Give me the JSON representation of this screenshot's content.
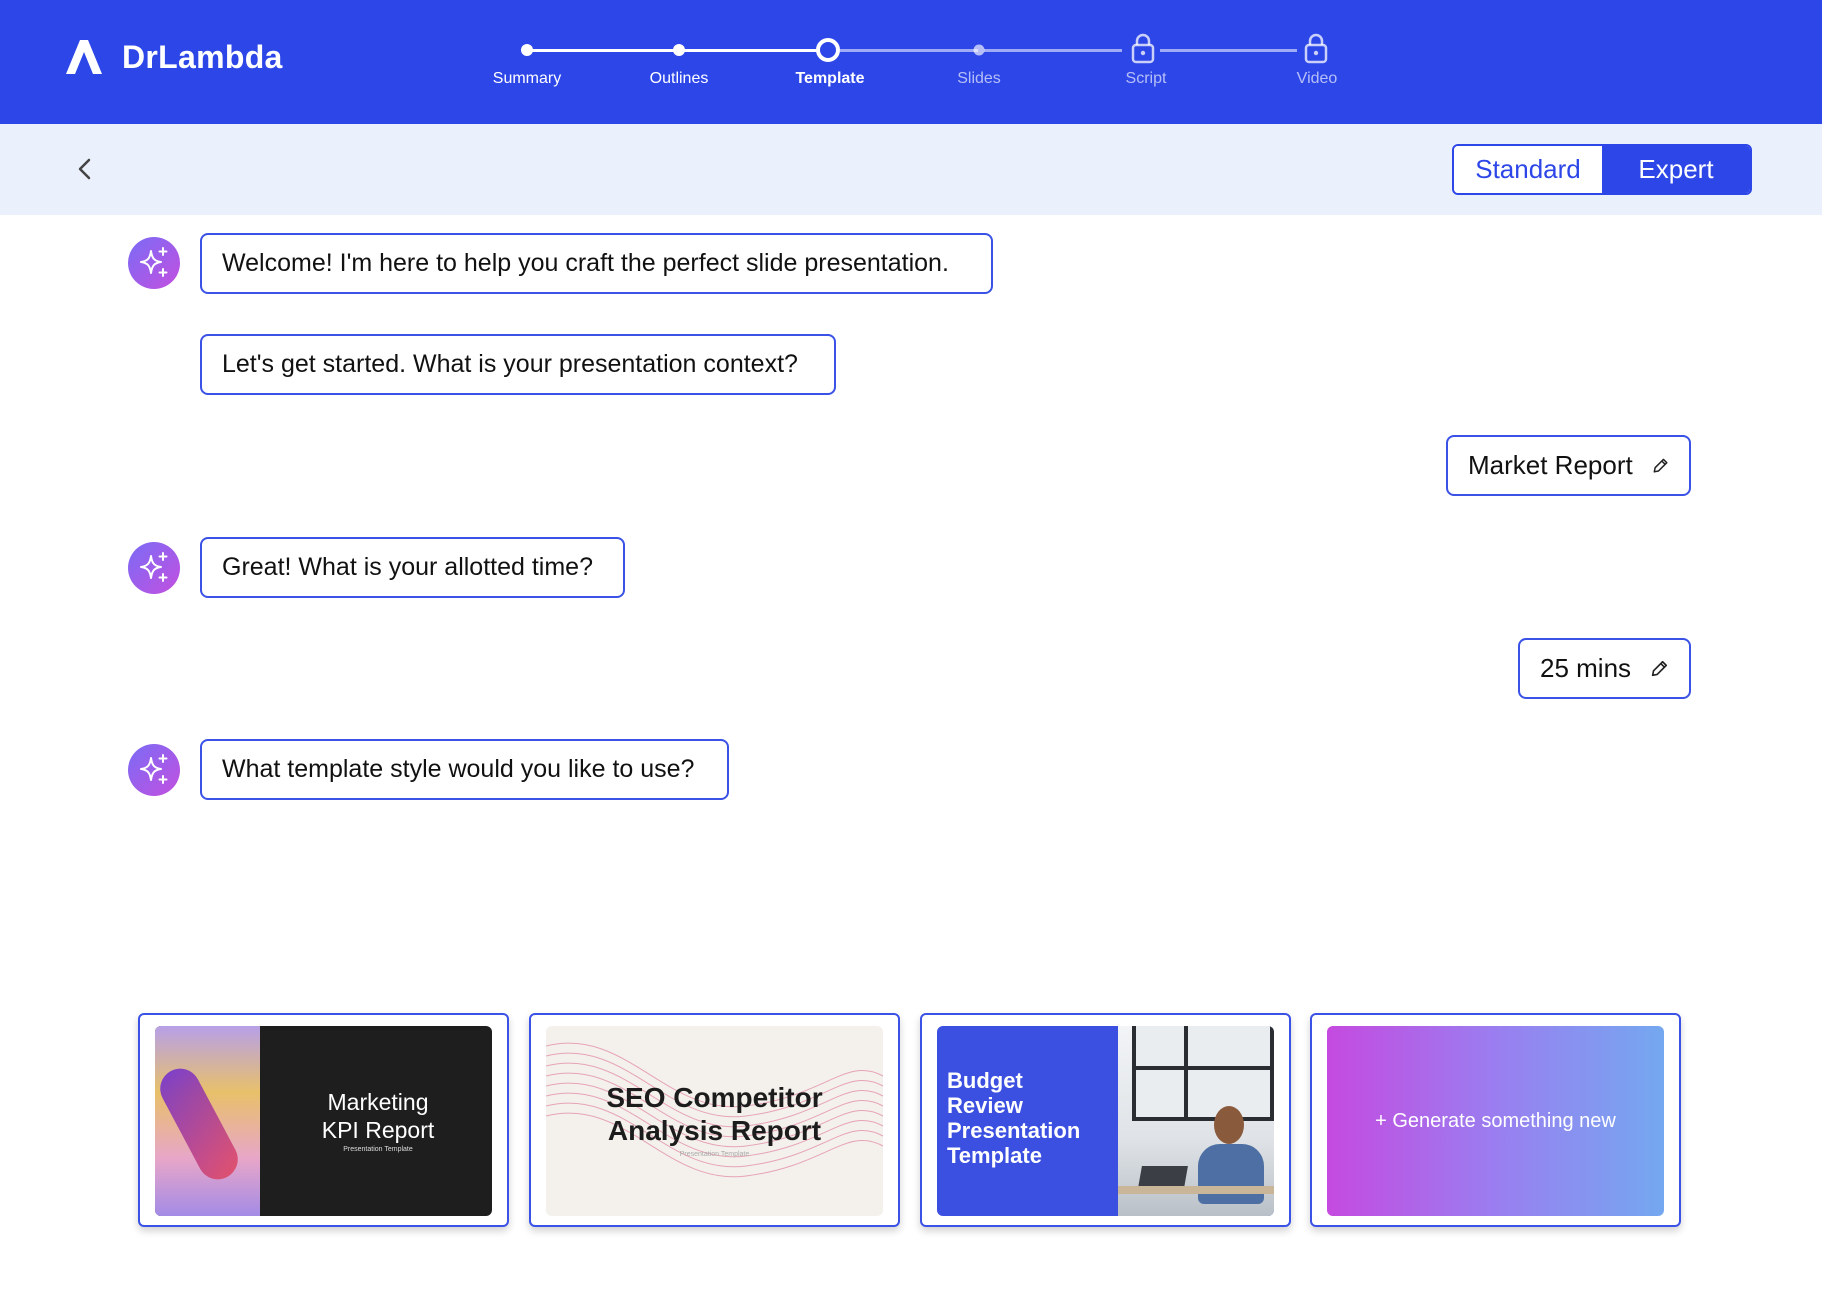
{
  "app": {
    "name": "DrLambda"
  },
  "stepper": {
    "steps": [
      {
        "label": "Summary",
        "state": "done"
      },
      {
        "label": "Outlines",
        "state": "done"
      },
      {
        "label": "Template",
        "state": "current"
      },
      {
        "label": "Slides",
        "state": "todo"
      },
      {
        "label": "Script",
        "state": "locked"
      },
      {
        "label": "Video",
        "state": "locked"
      }
    ]
  },
  "toolbar": {
    "back_icon": "chevron-left-icon",
    "mode_options": [
      "Standard",
      "Expert"
    ],
    "selected_mode": "Expert"
  },
  "chat": {
    "assistant_icon": "sparkle-icon",
    "messages": [
      {
        "from": "assistant",
        "text": "Welcome! I'm here to help you craft the perfect slide presentation."
      },
      {
        "from": "assistant",
        "text": "Let's get started. What is your presentation context?"
      },
      {
        "from": "user",
        "text": "Market Report",
        "editable": true
      },
      {
        "from": "assistant",
        "text": "Great! What is your allotted time?"
      },
      {
        "from": "user",
        "text": "25 mins",
        "editable": true
      },
      {
        "from": "assistant",
        "text": "What template style would you like to use?"
      }
    ]
  },
  "templates": [
    {
      "title_line1": "Marketing",
      "title_line2": "KPI Report",
      "subtitle": "Presentation Template"
    },
    {
      "title_line1": "SEO Competitor",
      "title_line2": "Analysis Report",
      "subtitle": "Presentation Template"
    },
    {
      "title_line1": "Budget",
      "title_line2": "Review",
      "title_line3": "Presentation",
      "title_line4": "Template"
    },
    {
      "label": "+ Generate something new"
    }
  ],
  "colors": {
    "primary": "#2d46e8",
    "subbar": "#ebf0fd",
    "bubble_border": "#3a52e6",
    "avatar_gradient": [
      "#7a6cf5",
      "#c34fe0"
    ]
  }
}
